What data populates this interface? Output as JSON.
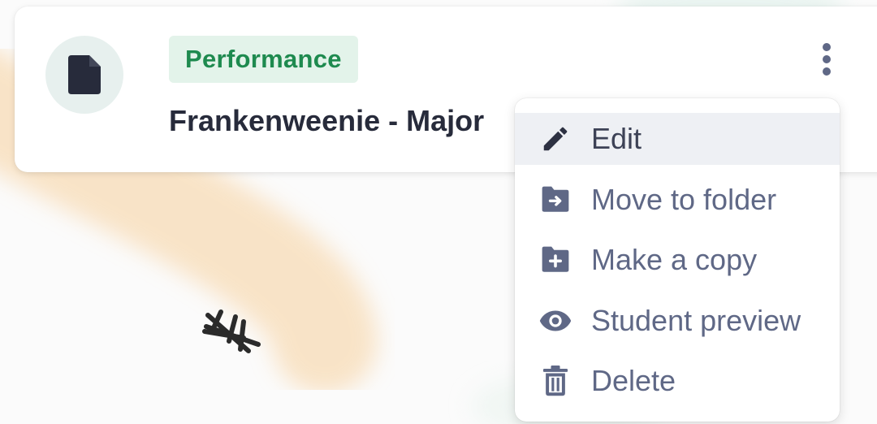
{
  "card": {
    "badge": "Performance",
    "title": "Frankenweenie - Major",
    "file_icon": "file-icon",
    "more_icon": "more-vertical-icon"
  },
  "menu": {
    "items": [
      {
        "label": "Edit",
        "icon": "pencil-icon",
        "active": true
      },
      {
        "label": "Move to folder",
        "icon": "folder-move-icon",
        "active": false
      },
      {
        "label": "Make a copy",
        "icon": "folder-plus-icon",
        "active": false
      },
      {
        "label": "Student preview",
        "icon": "eye-icon",
        "active": false
      },
      {
        "label": "Delete",
        "icon": "trash-icon",
        "active": false
      }
    ]
  },
  "colors": {
    "badge_bg": "#e3f3ea",
    "badge_text": "#1e8a4f",
    "title_text": "#272b3b",
    "menu_text": "#5f6886",
    "menu_active_bg": "#eef0f4",
    "icon_color": "#5f6886",
    "file_icon": "#272b3b"
  }
}
